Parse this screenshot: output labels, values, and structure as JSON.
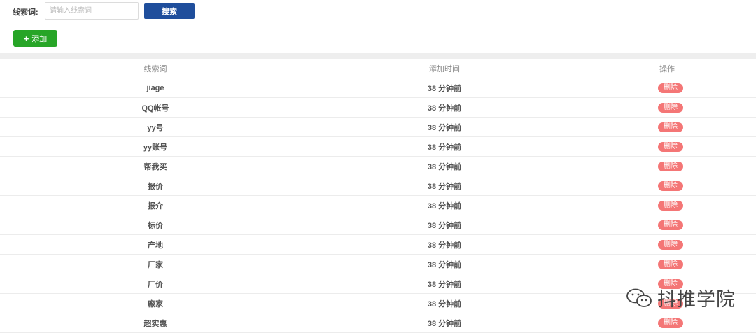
{
  "search": {
    "label": "线索词:",
    "placeholder": "请输入线索词",
    "value": "",
    "button_label": "搜索"
  },
  "actions": {
    "add_label": "添加",
    "add_icon": "plus-icon"
  },
  "table": {
    "headers": [
      "线索词",
      "添加时间",
      "操作"
    ],
    "delete_label": "删除",
    "rows": [
      {
        "keyword": "jiage",
        "time": "38 分钟前"
      },
      {
        "keyword": "QQ帐号",
        "time": "38 分钟前"
      },
      {
        "keyword": "yy号",
        "time": "38 分钟前"
      },
      {
        "keyword": "yy账号",
        "time": "38 分钟前"
      },
      {
        "keyword": "帮我买",
        "time": "38 分钟前"
      },
      {
        "keyword": "报价",
        "time": "38 分钟前"
      },
      {
        "keyword": "报介",
        "time": "38 分钟前"
      },
      {
        "keyword": "标价",
        "time": "38 分钟前"
      },
      {
        "keyword": "产地",
        "time": "38 分钟前"
      },
      {
        "keyword": "厂家",
        "time": "38 分钟前"
      },
      {
        "keyword": "厂价",
        "time": "38 分钟前"
      },
      {
        "keyword": "廠家",
        "time": "38 分钟前"
      },
      {
        "keyword": "超实惠",
        "time": "38 分钟前"
      }
    ]
  },
  "watermark": {
    "text": "抖推学院",
    "icon": "wechat-icon"
  },
  "colors": {
    "search_button": "#1f4e9c",
    "add_button": "#27a527",
    "delete_button": "#f47676"
  }
}
